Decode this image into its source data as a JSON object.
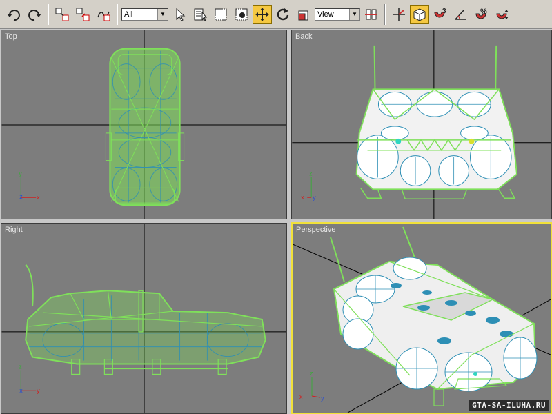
{
  "toolbar": {
    "selection_filter": "All",
    "reference_coord": "View",
    "snap_angle_label": "%",
    "snap_count_label": "3"
  },
  "viewports": {
    "top": "Top",
    "back": "Back",
    "right": "Right",
    "perspective": "Perspective"
  },
  "watermark": "GTA-SA-ILUHA.RU",
  "axes": {
    "x": "x",
    "y": "y",
    "z": "z"
  },
  "colors": {
    "wire": "#7fe05a",
    "wire_inner": "#2d8fb5",
    "grid_line": "#000000",
    "active_border": "#f1e13a",
    "viewport_bg": "#7d7d7d"
  }
}
